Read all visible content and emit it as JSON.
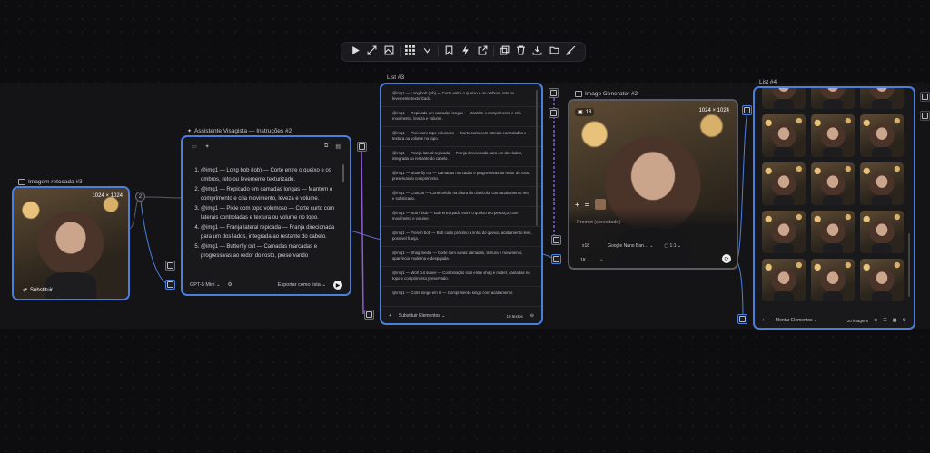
{
  "toolbar": {
    "items": [
      "play-icon",
      "expand-icon",
      "frame-icon",
      "grid-icon",
      "chevron-down-icon",
      "bookmark-icon",
      "bolt-icon",
      "export-icon",
      "duplicate-icon",
      "trash-icon",
      "download-icon",
      "folder-icon",
      "brush-icon"
    ]
  },
  "node1": {
    "title": "Imagem retocada #3",
    "size": "1024 × 1024",
    "replace_label": "Substituir",
    "port_label": "2"
  },
  "node2": {
    "title": "Assistente Visagista — Instruções #2",
    "items": [
      "@img1 — Long bob (lob) — Corte entre o queixo e os ombros, reto ou levemente texturizado.",
      "@img1 — Repicado em camadas longas — Mantém o comprimento e cria movimento, leveza e volume.",
      "@img1 — Pixie com topo volumoso — Corte curto com laterais controladas e textura ou volume no topo.",
      "@img1 — Franja lateral repicada — Franja direcionada para um dos lados, integrada ao restante do cabelo.",
      "@img1 — Butterfly cut — Camadas marcadas e progressivas ao redor do rosto, preservando"
    ],
    "model": "GPT-5 Mini",
    "action": "Exportar como lista"
  },
  "node3": {
    "title": "List #3",
    "items": [
      "@img1 — Long bob (lob) — Corte entre o queixo e os ombros, reto ou levemente texturizado.",
      "@img1 — Repicado em camadas longas — Mantém o comprimento e cria movimento, leveza e volume.",
      "@img1 — Pixie com topo volumoso — Corte curto com laterais controladas e textura ou volume no topo.",
      "@img1 — Franja lateral repicada — Franja direcionada para um dos lados, integrada ao restante do cabelo.",
      "@img1 — Butterfly cut — Camadas marcadas e progressivas ao redor do rosto, preservando comprimento.",
      "@img1 — Coucou — Corte médio na altura do clavículo, com acabamento reto e sofisticado.",
      "@img1 — Bob's bob — Bob encorpado entre o queixo e o pescoço, com movimento e volume.",
      "@img1 — French bob — Bob curto próximo à linha do queixo, acabamento leve, possível franja.",
      "@img1 — Shag médio — Corte com várias camadas, textura e movimento, aparência moderna e despojada.",
      "@img1 — Wolf cut suave — Combinação sutil entre shag e mullet, camadas no topo e comprimento preservado.",
      "@img1 — Corte longo em U — Comprimento longo com acabamento"
    ],
    "footer_action": "Substituir Elementos",
    "count": "10 textos"
  },
  "node4": {
    "title": "Image Generator #2",
    "count_badge": "18",
    "size": "1024 × 1024",
    "prompt_placeholder": "Prompt (conectado)",
    "count": "x18",
    "model": "Google Nano Ban…",
    "ratio": "1:1",
    "resolution": "1K"
  },
  "node5": {
    "title": "List #4",
    "footer_action": "Montar Elementos",
    "count": "20 imagens"
  }
}
